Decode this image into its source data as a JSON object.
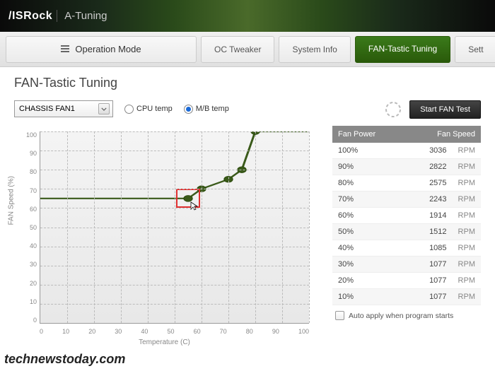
{
  "brand": "/ISRock",
  "brand_suffix": "A-Tuning",
  "tabs": {
    "operation": "Operation Mode",
    "oc": "OC Tweaker",
    "sysinfo": "System Info",
    "fantastic": "FAN-Tastic Tuning",
    "settings": "Sett"
  },
  "page_title": "FAN-Tastic Tuning",
  "dropdown_value": "CHASSIS FAN1",
  "radios": {
    "cpu": "CPU temp",
    "mb": "M/B temp"
  },
  "chart_data": {
    "type": "line",
    "xlabel": "Temperature (C)",
    "ylabel": "FAN Speed (%)",
    "xlim": [
      0,
      100
    ],
    "ylim": [
      0,
      100
    ],
    "xticks": [
      "0",
      "10",
      "20",
      "30",
      "40",
      "50",
      "60",
      "70",
      "80",
      "90",
      "100"
    ],
    "yticks": [
      "100",
      "90",
      "80",
      "70",
      "60",
      "50",
      "40",
      "30",
      "20",
      "10",
      "0"
    ],
    "points": [
      {
        "x": 55,
        "y": 65
      },
      {
        "x": 60,
        "y": 70
      },
      {
        "x": 70,
        "y": 75
      },
      {
        "x": 75,
        "y": 80
      },
      {
        "x": 80,
        "y": 100
      }
    ],
    "flat_before": 65,
    "flat_after": 100,
    "highlight_point_index": 0
  },
  "test_button": "Start FAN Test",
  "table": {
    "headers": {
      "power": "Fan Power",
      "speed": "Fan Speed"
    },
    "unit": "RPM",
    "rows": [
      {
        "power": "100%",
        "speed": "3036"
      },
      {
        "power": "90%",
        "speed": "2822"
      },
      {
        "power": "80%",
        "speed": "2575"
      },
      {
        "power": "70%",
        "speed": "2243"
      },
      {
        "power": "60%",
        "speed": "1914"
      },
      {
        "power": "50%",
        "speed": "1512"
      },
      {
        "power": "40%",
        "speed": "1085"
      },
      {
        "power": "30%",
        "speed": "1077"
      },
      {
        "power": "20%",
        "speed": "1077"
      },
      {
        "power": "10%",
        "speed": "1077"
      }
    ]
  },
  "auto_apply": "Auto apply when program starts",
  "watermark": "technewstoday.com"
}
